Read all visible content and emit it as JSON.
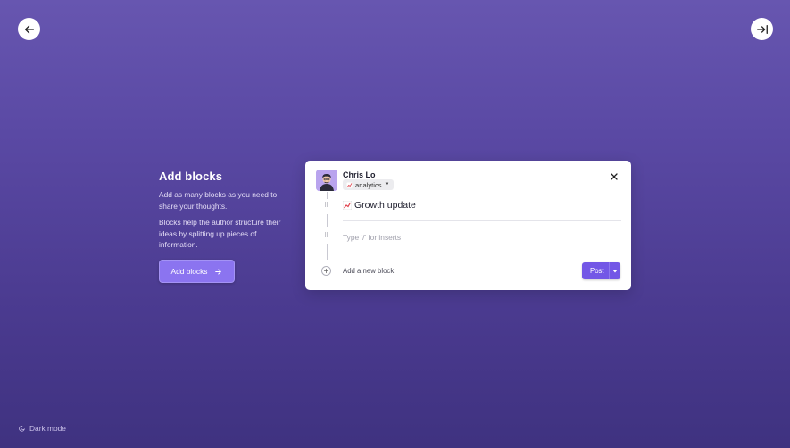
{
  "nav": {
    "back_icon": "arrow-left-icon",
    "collapse_icon": "arrow-right-to-bar-icon"
  },
  "intro": {
    "title": "Add blocks",
    "paragraph1": "Add as many blocks as you need to share your thoughts.",
    "paragraph2": "Blocks help the author structure their ideas by splitting up pieces of information.",
    "button_label": "Add blocks"
  },
  "composer": {
    "author_name": "Chris Lo",
    "tag_label": "analytics",
    "blocks": [
      {
        "text": "Growth update",
        "icon": "chart-increasing-emoji"
      },
      {
        "placeholder": "Type '/' for inserts"
      }
    ],
    "add_block_label": "Add a new block",
    "post_label": "Post"
  },
  "footer": {
    "dark_mode_label": "Dark mode"
  },
  "colors": {
    "accent": "#7357e6",
    "primary_button": "#8b74f0",
    "background_top": "#6756b0",
    "background_bottom": "#3f3280"
  }
}
